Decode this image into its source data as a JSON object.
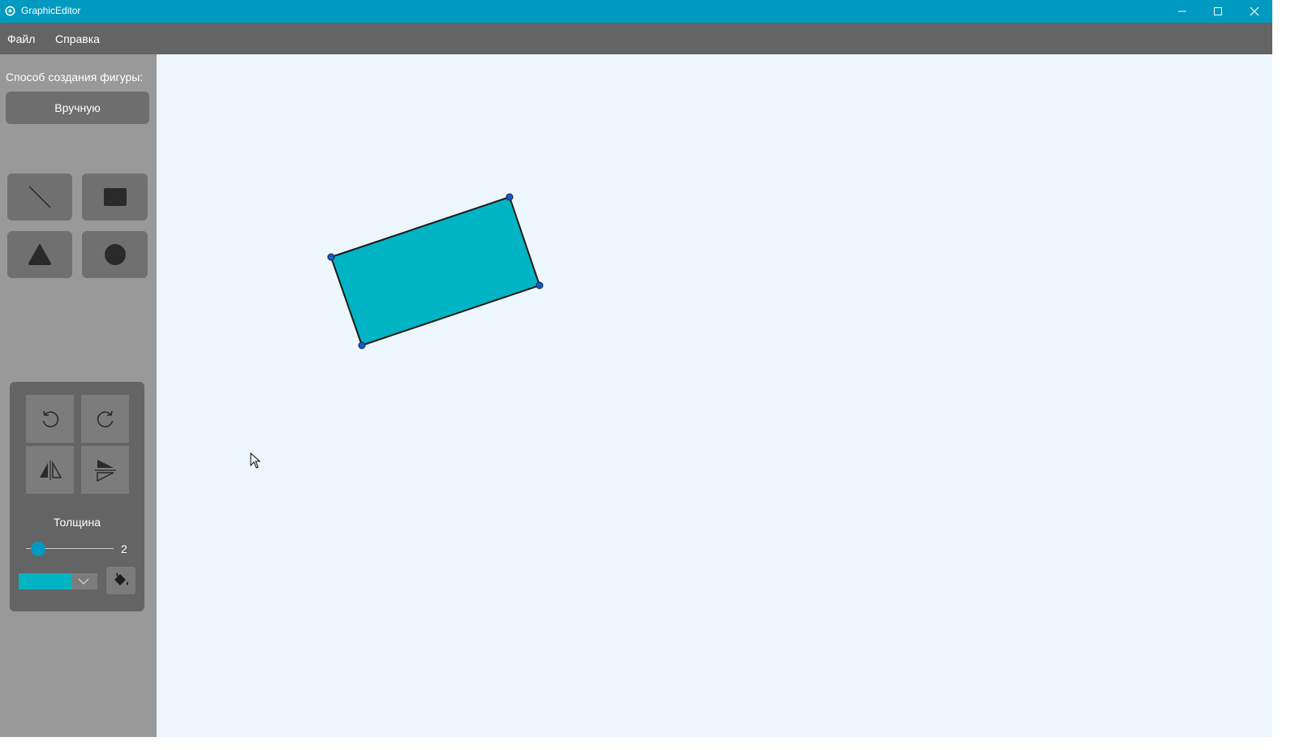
{
  "window": {
    "title": "GraphicEditor",
    "accent_color": "#009ac0"
  },
  "menu": {
    "items": [
      {
        "label": "Файл"
      },
      {
        "label": "Справка"
      }
    ]
  },
  "sidebar": {
    "mode_label": "Способ создания фигуры:",
    "mode_button": "Вручную",
    "tools": [
      {
        "name": "line",
        "icon": "line-icon"
      },
      {
        "name": "rectangle",
        "icon": "rectangle-icon"
      },
      {
        "name": "triangle",
        "icon": "triangle-icon"
      },
      {
        "name": "circle",
        "icon": "circle-icon"
      }
    ],
    "transform": {
      "buttons": [
        {
          "name": "rotate-left",
          "icon": "rotate-left-icon"
        },
        {
          "name": "rotate-right",
          "icon": "rotate-right-icon"
        },
        {
          "name": "flip-vertical",
          "icon": "flip-vertical-icon"
        },
        {
          "name": "flip-horizontal",
          "icon": "flip-horizontal-icon"
        }
      ],
      "thickness_label": "Толщина",
      "thickness_value": "2",
      "fill_color": "#00b4c4",
      "fill_icon": "paint-bucket-icon"
    }
  },
  "canvas": {
    "background": "#eef7fe",
    "shape": {
      "type": "rectangle",
      "fill": "#00b4c4",
      "stroke": "#1a1a1a",
      "handle_color": "#1a5ac8"
    }
  }
}
